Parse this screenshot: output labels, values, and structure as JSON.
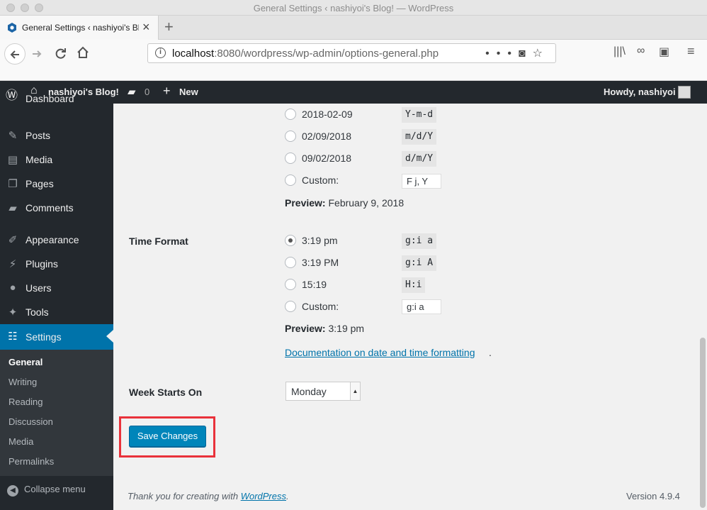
{
  "window": {
    "title": "General Settings ‹ nashiyoi's Blog! — WordPress"
  },
  "browser": {
    "tab_title": "General Settings ‹ nashiyoi's Blo",
    "url_host": "localhost",
    "url_rest": ":8080/wordpress/wp-admin/options-general.php",
    "icons": [
      "back-icon",
      "forward-icon",
      "reload-icon",
      "home-icon",
      "info-icon",
      "more-icon",
      "pocket-icon",
      "bookmark-star-icon",
      "library-icon",
      "reader-icon",
      "sidebar-icon",
      "menu-icon"
    ]
  },
  "adminbar": {
    "site_name": "nashiyoi's Blog!",
    "comments_count": "0",
    "new_label": "New",
    "howdy": "Howdy, nashiyoi"
  },
  "sidebar": {
    "dashboard": "Dashboard",
    "items": [
      {
        "label": "Posts",
        "icon": "pin-icon"
      },
      {
        "label": "Media",
        "icon": "media-icon"
      },
      {
        "label": "Pages",
        "icon": "pages-icon"
      },
      {
        "label": "Comments",
        "icon": "comment-icon"
      },
      {
        "label": "Appearance",
        "icon": "brush-icon"
      },
      {
        "label": "Plugins",
        "icon": "plugin-icon"
      },
      {
        "label": "Users",
        "icon": "user-icon"
      },
      {
        "label": "Tools",
        "icon": "wrench-icon"
      },
      {
        "label": "Settings",
        "icon": "settings-icon"
      }
    ],
    "submenu": [
      "General",
      "Writing",
      "Reading",
      "Discussion",
      "Media",
      "Permalinks"
    ],
    "collapse": "Collapse menu"
  },
  "date_format": {
    "options": [
      {
        "label": "2018-02-09",
        "code": "Y-m-d"
      },
      {
        "label": "02/09/2018",
        "code": "m/d/Y"
      },
      {
        "label": "09/02/2018",
        "code": "d/m/Y"
      },
      {
        "label": "Custom:",
        "value": "F j, Y"
      }
    ],
    "preview_label": "Preview:",
    "preview_value": "February 9, 2018"
  },
  "time_format": {
    "label": "Time Format",
    "options": [
      {
        "label": "3:19 pm",
        "code": "g:i a",
        "checked": true
      },
      {
        "label": "3:19 PM",
        "code": "g:i A"
      },
      {
        "label": "15:19",
        "code": "H:i"
      },
      {
        "label": "Custom:",
        "value": "g:i a"
      }
    ],
    "preview_label": "Preview:",
    "preview_value": "3:19 pm",
    "doc_link": "Documentation on date and time formatting",
    "doc_dot": "."
  },
  "week": {
    "label": "Week Starts On",
    "selected": "Monday"
  },
  "save_label": "Save Changes",
  "footer": {
    "thanks": "Thank you for creating with",
    "wp_link": "WordPress",
    "dot": ".",
    "version": "Version 4.9.4"
  },
  "colors": {
    "accent": "#0073aa",
    "highlight": "#e9323b",
    "adminbar": "#23282d"
  }
}
